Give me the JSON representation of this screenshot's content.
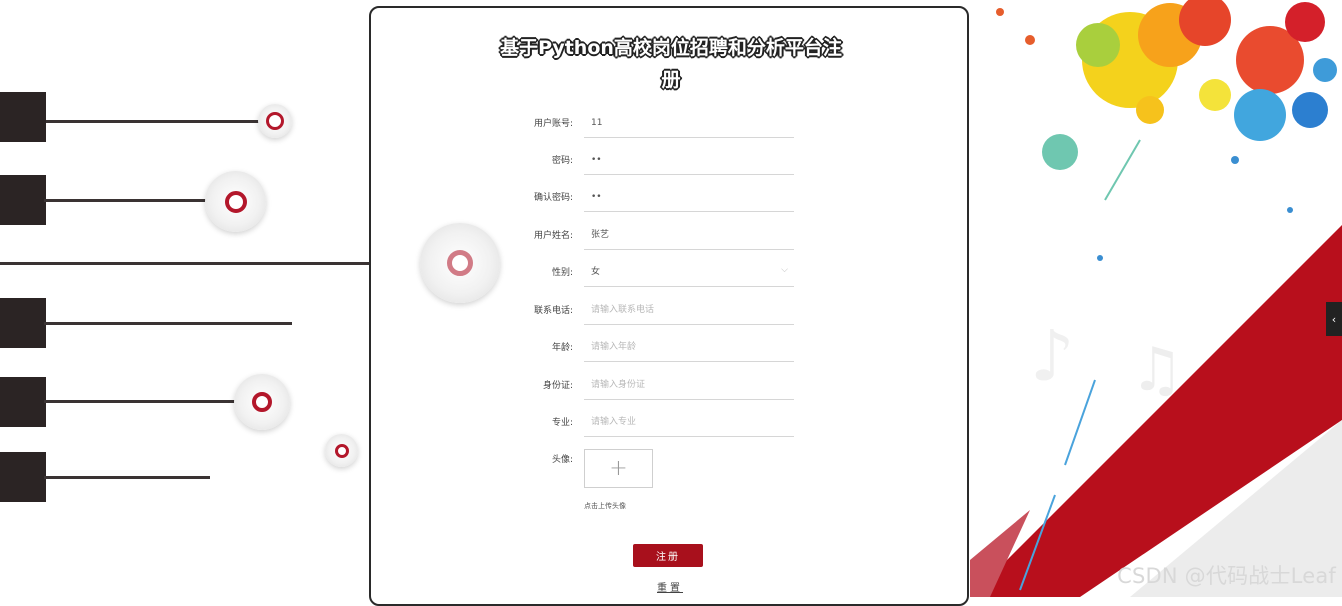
{
  "form": {
    "title_line1": "基于Python高校岗位招聘和分析平台注",
    "title_line2": "册",
    "fields": [
      {
        "label": "用户账号:",
        "value": "11",
        "placeholder": ""
      },
      {
        "label": "密码:",
        "value": "••",
        "placeholder": ""
      },
      {
        "label": "确认密码:",
        "value": "••",
        "placeholder": ""
      },
      {
        "label": "用户姓名:",
        "value": "张艺",
        "placeholder": ""
      },
      {
        "label": "性别:",
        "value": "女",
        "placeholder": ""
      },
      {
        "label": "联系电话:",
        "value": "",
        "placeholder": "请输入联系电话"
      },
      {
        "label": "年龄:",
        "value": "",
        "placeholder": "请输入年龄"
      },
      {
        "label": "身份证:",
        "value": "",
        "placeholder": "请输入身份证"
      },
      {
        "label": "专业:",
        "value": "",
        "placeholder": "请输入专业"
      }
    ],
    "avatar_label": "头像:",
    "upload_plus": "+",
    "upload_hint": "点击上传头像",
    "register_button": "注册",
    "reset_button": "重置",
    "gender_chevron": "⌵"
  },
  "side_tab_icon": "‹",
  "watermark": "CSDN @代码战士Leaf",
  "colors": {
    "accent_red": "#a8101c",
    "panel_border": "#2a2a2a"
  },
  "icons": {
    "upload": "plus-icon",
    "select": "chevron-down-icon",
    "side_tab": "chevron-left-icon"
  }
}
